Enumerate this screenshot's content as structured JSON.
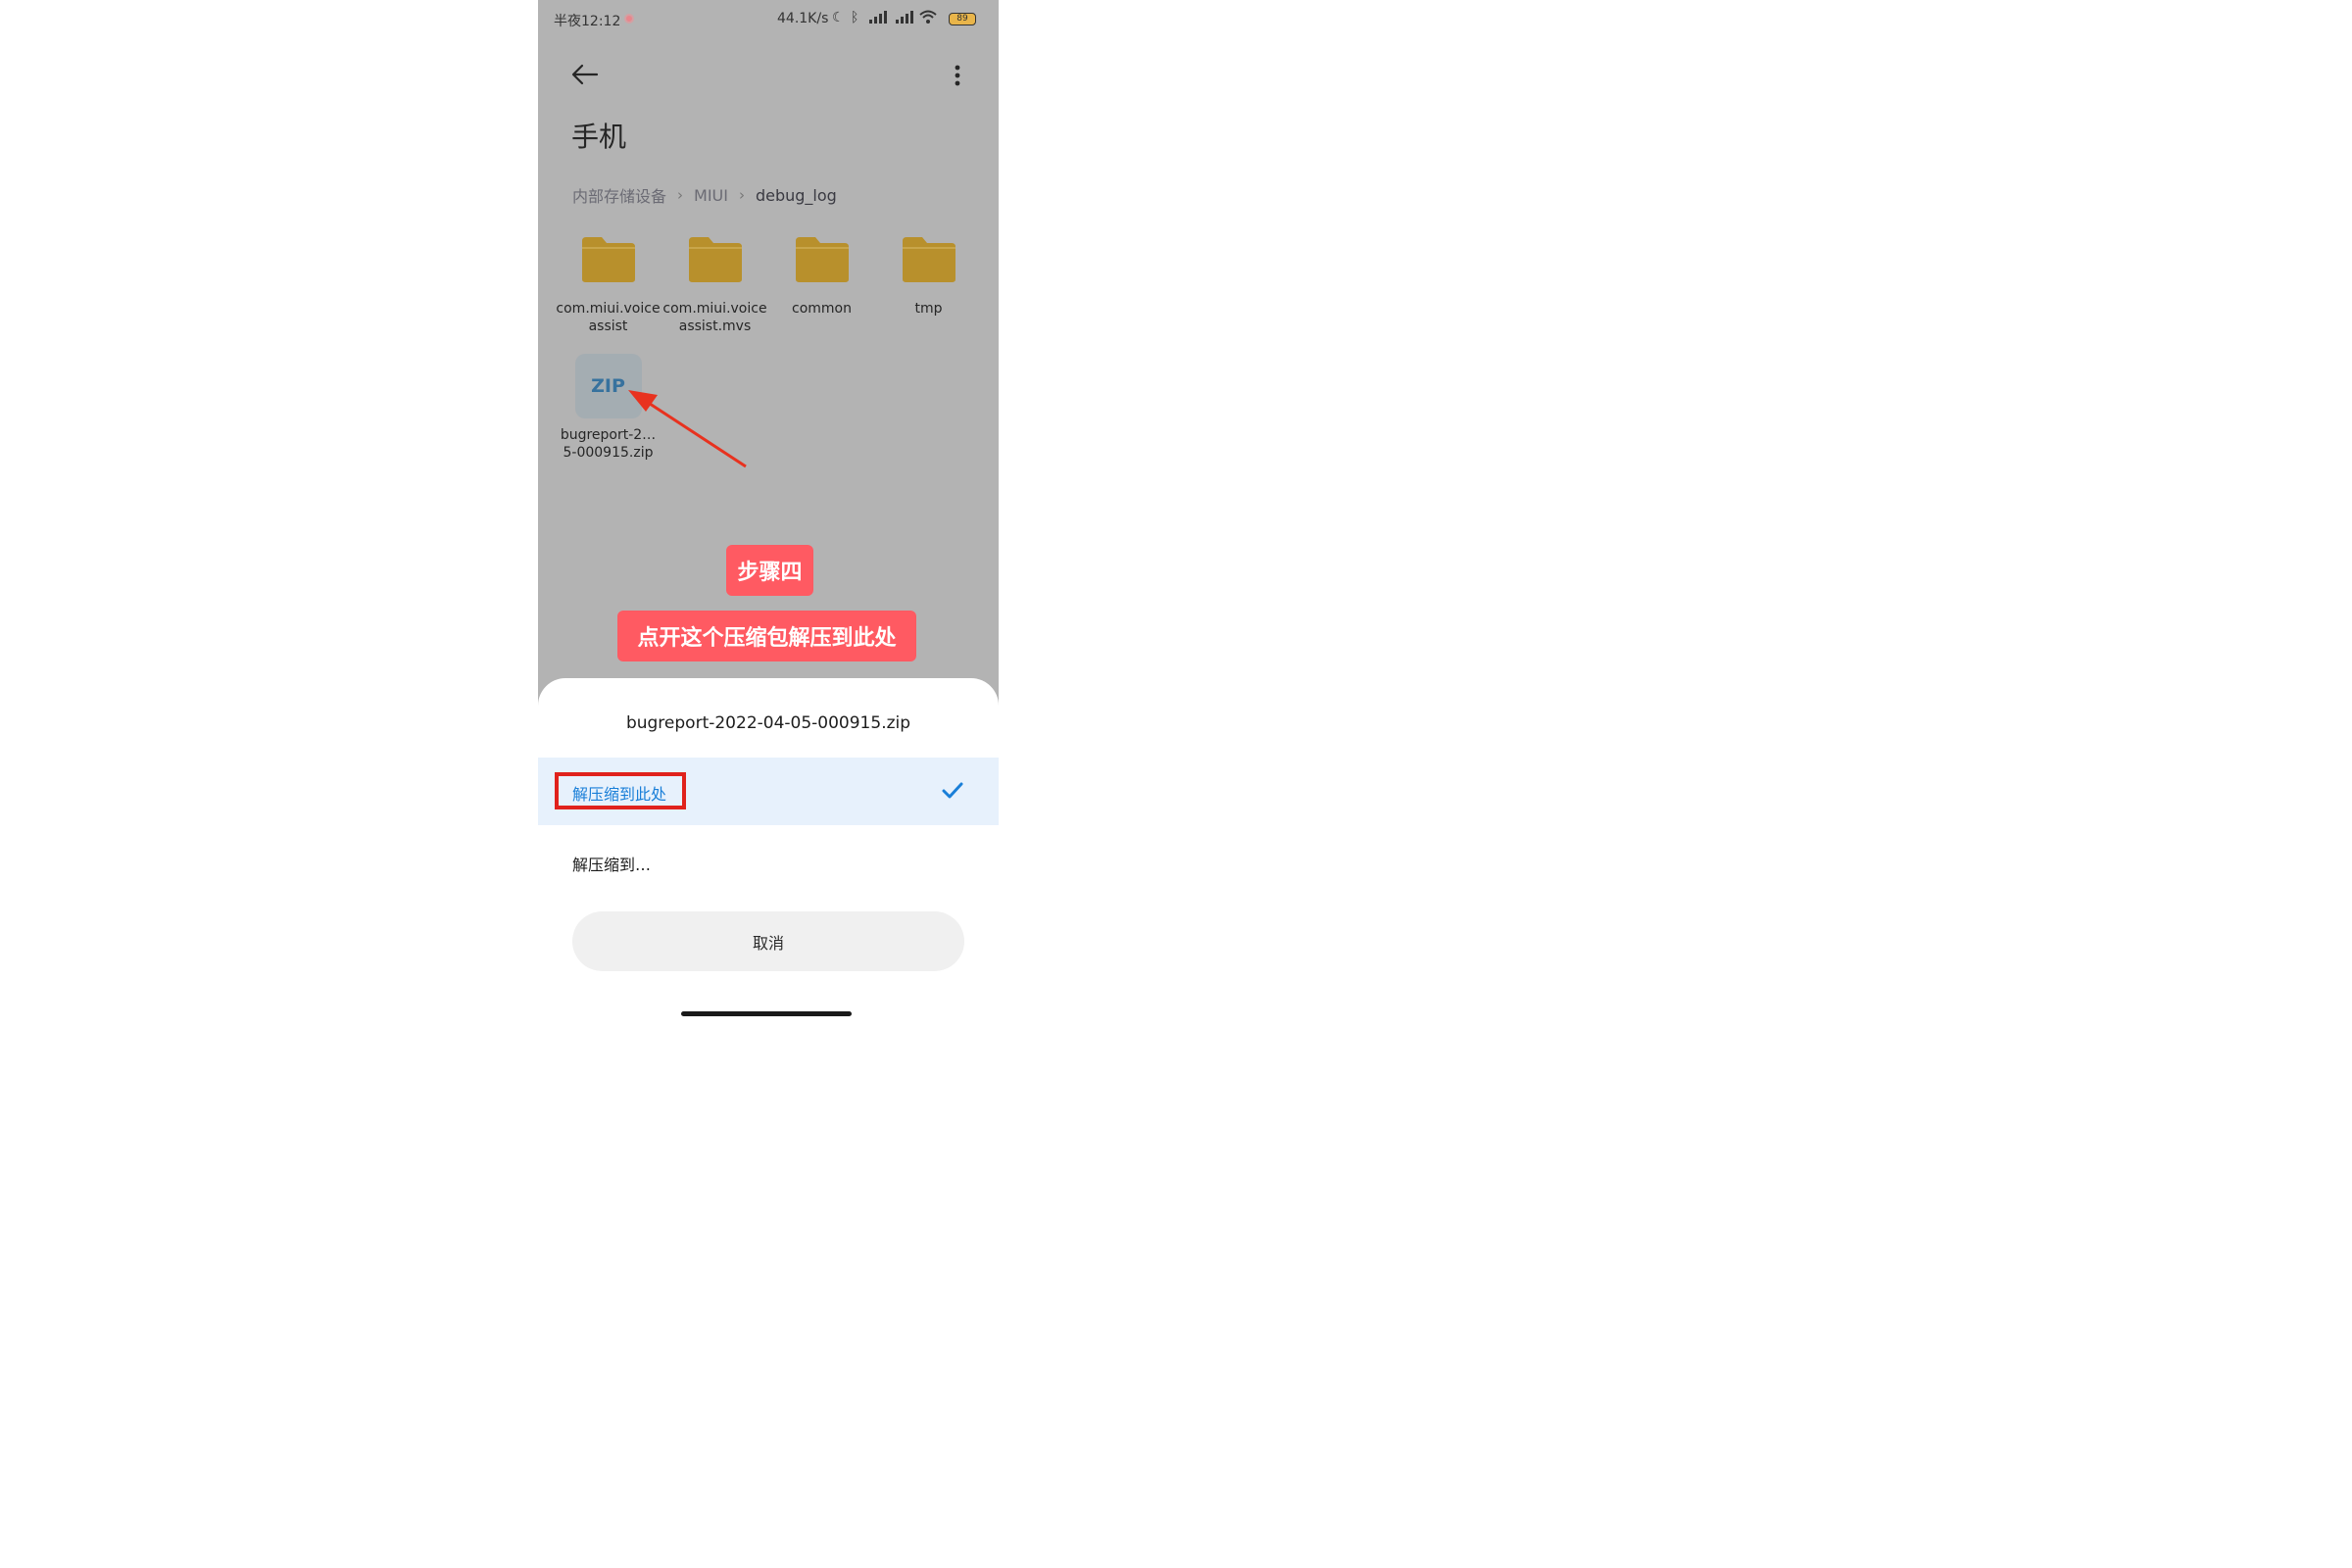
{
  "status_bar": {
    "time": "半夜12:12",
    "net_speed": "44.1K/s",
    "icons": [
      "moon-icon",
      "bluetooth-icon",
      "signal-hd-icon",
      "signal-hd-icon",
      "wifi-icon"
    ],
    "battery": "89"
  },
  "header": {
    "title": "手机"
  },
  "breadcrumb": {
    "items": [
      "内部存储设备",
      "MIUI",
      "debug_log"
    ]
  },
  "files": [
    {
      "label": "com.miui.voice assist",
      "type": "folder"
    },
    {
      "label": "com.miui.voice assist.mvs",
      "type": "folder"
    },
    {
      "label": "common",
      "type": "folder"
    },
    {
      "label": "tmp",
      "type": "folder"
    },
    {
      "label": "bugreport-2… 5-000915.zip",
      "type": "zip",
      "icon_text": "ZIP"
    }
  ],
  "annotation": {
    "step": "步骤四",
    "note": "点开这个压缩包解压到此处"
  },
  "sheet": {
    "title": "bugreport-2022-04-05-000915.zip",
    "option_selected": "解压缩到此处",
    "option_other": "解压缩到…",
    "cancel": "取消"
  },
  "colors": {
    "folder": "#b8902c",
    "accent": "#1a7fd8",
    "annotation_red": "#ff5a62",
    "highlight_border": "#e0221c"
  }
}
